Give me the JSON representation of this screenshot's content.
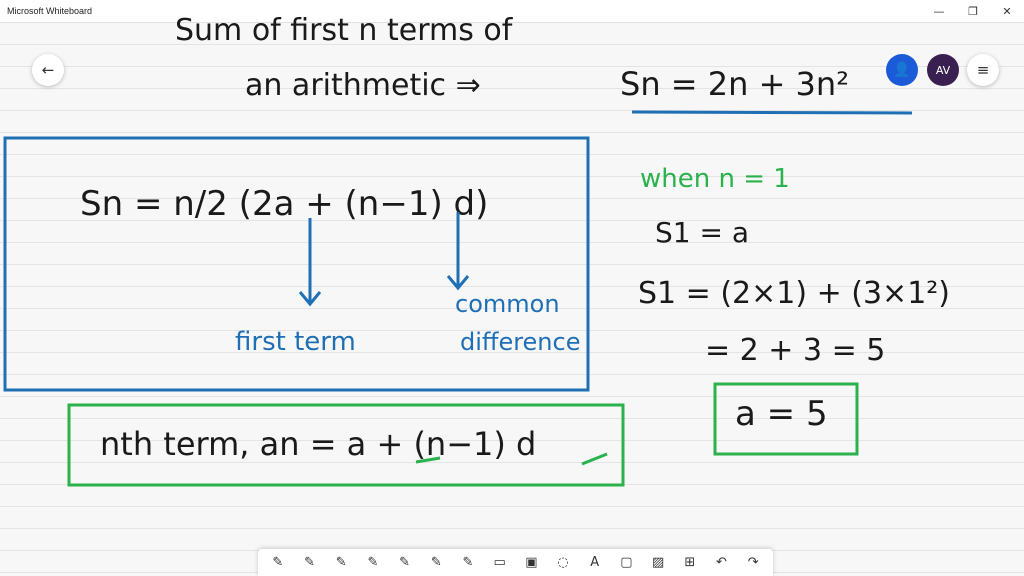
{
  "window": {
    "title": "Microsoft Whiteboard",
    "controls": {
      "minimize": "—",
      "restore": "❐",
      "close": "✕"
    }
  },
  "header": {
    "back_icon": "←",
    "user_icon": "👤",
    "avatar_initials": "AV",
    "menu_icon": "≡"
  },
  "whiteboard": {
    "question_line1": "Sum of first n terms of",
    "question_line2": "an arithmetic ⇒",
    "given_sn": "Sn = 2n + 3n²",
    "formula_box": {
      "formula": "Sn = n/2 (2a + (n−1) d)",
      "label_a": "first term",
      "label_d_line1": "common",
      "label_d_line2": "difference"
    },
    "nth_term_box": {
      "text": "nth term, an = a + (n−1) d"
    },
    "working": {
      "when": "when n = 1",
      "s1_eq_a": "S1 = a",
      "s1_calc": "S1 = (2×1) + (3×1²)",
      "result": "= 2 + 3 = 5",
      "answer": "a = 5"
    },
    "colors": {
      "ink_black": "#1a1a1a",
      "ink_blue": "#1f6fb5",
      "ink_green": "#2bb24c",
      "box_blue": "#1f6fb5",
      "box_green": "#2bb24c"
    }
  },
  "toolbar": {
    "tools": [
      {
        "name": "pen-black",
        "icon": "✎"
      },
      {
        "name": "pen-red",
        "icon": "✎"
      },
      {
        "name": "pen-blue",
        "icon": "✎"
      },
      {
        "name": "pen-green",
        "icon": "✎"
      },
      {
        "name": "pen-2",
        "icon": "✎"
      },
      {
        "name": "pen-3",
        "icon": "✎"
      },
      {
        "name": "highlighter",
        "icon": "✎"
      },
      {
        "name": "eraser",
        "icon": "▭"
      },
      {
        "name": "ruler",
        "icon": "▣"
      },
      {
        "name": "lasso",
        "icon": "◌"
      },
      {
        "name": "text",
        "icon": "A"
      },
      {
        "name": "note",
        "icon": "▢"
      },
      {
        "name": "image",
        "icon": "▨"
      },
      {
        "name": "insert",
        "icon": "⊞"
      },
      {
        "name": "undo",
        "icon": "↶"
      },
      {
        "name": "redo",
        "icon": "↷"
      }
    ]
  }
}
